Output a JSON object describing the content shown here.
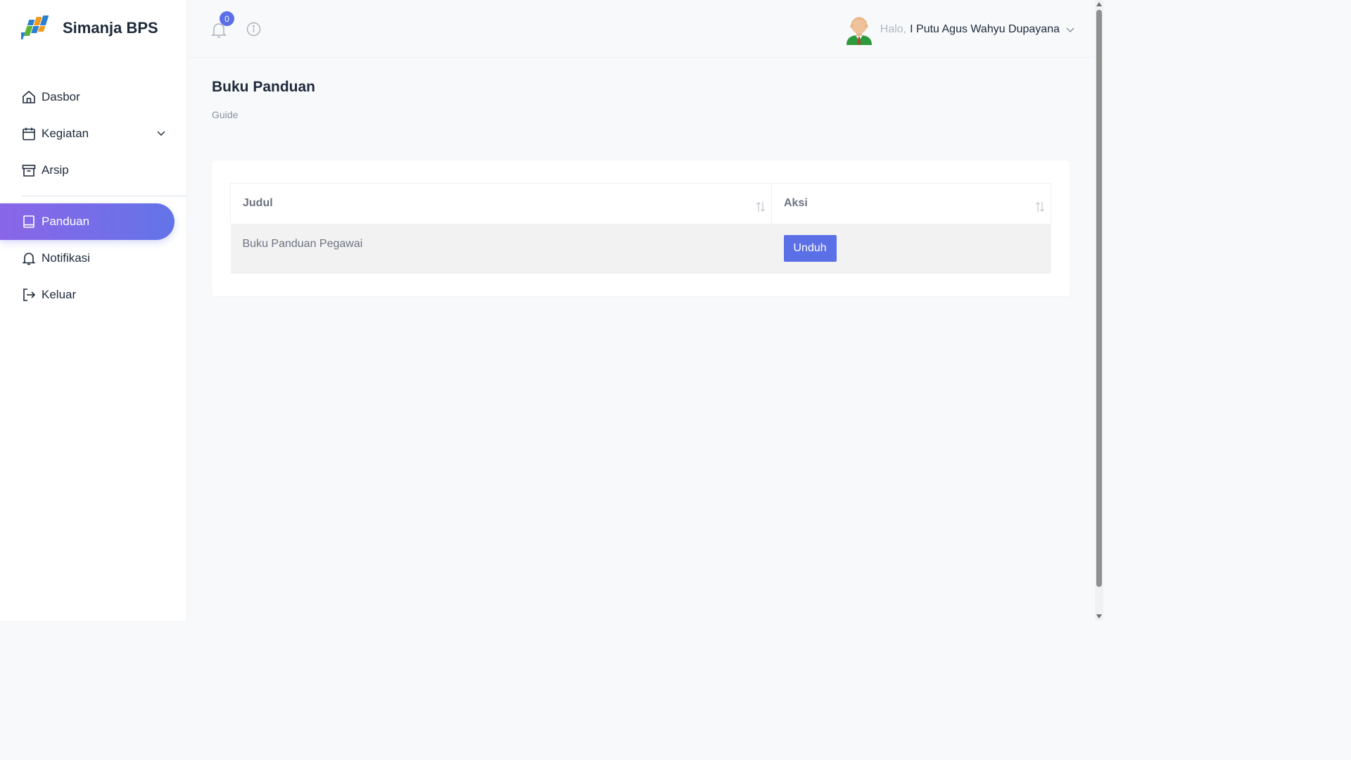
{
  "brand": {
    "name": "Simanja BPS"
  },
  "sidebar": {
    "items": [
      {
        "label": "Dasbor",
        "icon": "home-icon"
      },
      {
        "label": "Kegiatan",
        "icon": "calendar-icon"
      },
      {
        "label": "Arsip",
        "icon": "archive-icon"
      },
      {
        "label": "Panduan",
        "icon": "book-icon",
        "active": true
      },
      {
        "label": "Notifikasi",
        "icon": "bell-icon"
      },
      {
        "label": "Keluar",
        "icon": "logout-icon"
      }
    ]
  },
  "topbar": {
    "notification_count": "0",
    "greeting": "Halo,",
    "user_name": "I Putu Agus Wahyu Dupayana"
  },
  "page": {
    "title": "Buku Panduan",
    "subtitle": "Guide"
  },
  "table": {
    "headers": [
      "Judul",
      "Aksi"
    ],
    "rows": [
      {
        "title": "Buku Panduan Pegawai",
        "action": "Unduh"
      }
    ]
  },
  "colors": {
    "accent": "#5b6fe6",
    "active_gradient_start": "#8a66e8",
    "active_gradient_end": "#6374e8"
  }
}
